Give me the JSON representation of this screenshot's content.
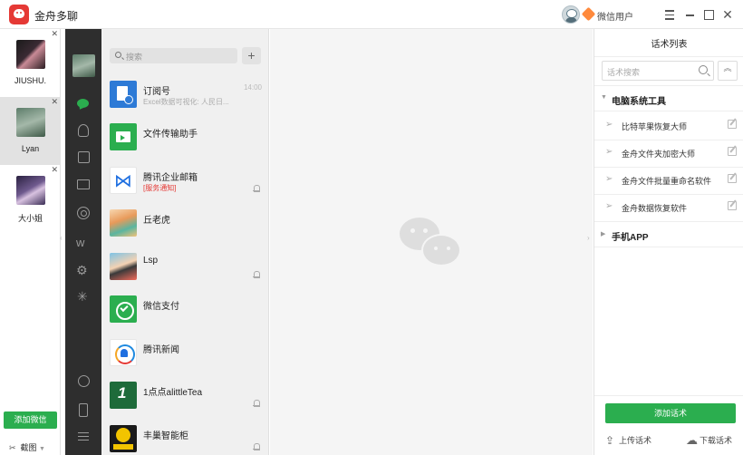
{
  "app": {
    "title": "金舟多聊",
    "user_label": "微信用户"
  },
  "accounts": [
    {
      "name": "JIUSHU.",
      "active": false
    },
    {
      "name": "Lyan",
      "active": true
    },
    {
      "name": "大小姐",
      "active": false
    }
  ],
  "account_actions": {
    "add_wechat": "添加微信",
    "screenshot": "截图"
  },
  "chat_list": {
    "search_placeholder": "搜索",
    "add": "+",
    "items": [
      {
        "title": "订阅号",
        "sub": "Excel数据可视化: 人民日...",
        "time": "14:00",
        "muted": false,
        "sub_red": false,
        "avatar": "blue-doc"
      },
      {
        "title": "文件传输助手",
        "sub": "",
        "time": "",
        "muted": false,
        "sub_red": false,
        "avatar": "file"
      },
      {
        "title": "腾讯企业邮箱",
        "sub": "[服务通知]",
        "time": "",
        "muted": true,
        "sub_red": true,
        "avatar": "mail"
      },
      {
        "title": "丘老虎",
        "sub": "",
        "time": "",
        "muted": false,
        "sub_red": false,
        "avatar": "girl"
      },
      {
        "title": "Lsp",
        "sub": "",
        "time": "",
        "muted": true,
        "sub_red": false,
        "avatar": "cartoon"
      },
      {
        "title": "微信支付",
        "sub": "",
        "time": "",
        "muted": false,
        "sub_red": false,
        "avatar": "pay"
      },
      {
        "title": "腾讯新闻",
        "sub": "",
        "time": "",
        "muted": false,
        "sub_red": false,
        "avatar": "news"
      },
      {
        "title": "1点点alittleTea",
        "sub": "",
        "time": "",
        "muted": true,
        "sub_red": false,
        "avatar": "tea"
      },
      {
        "title": "丰巢智能柜",
        "sub": "",
        "time": "",
        "muted": true,
        "sub_red": false,
        "avatar": "locker"
      }
    ]
  },
  "script_panel": {
    "title": "话术列表",
    "search_placeholder": "话术搜索",
    "collapse": "︽",
    "category_pc": "电脑系统工具",
    "category_mobile": "手机APP",
    "items": [
      "比特苹果恢复大师",
      "金舟文件夹加密大师",
      "金舟文件批量重命名软件",
      "金舟数据恢复软件"
    ],
    "add_script": "添加话术",
    "upload": "上传话术",
    "download": "下载话术"
  },
  "colors": {
    "accent_green": "#2bae4f",
    "nav_dark": "#2e2e2e",
    "brand_red": "#e53935"
  }
}
